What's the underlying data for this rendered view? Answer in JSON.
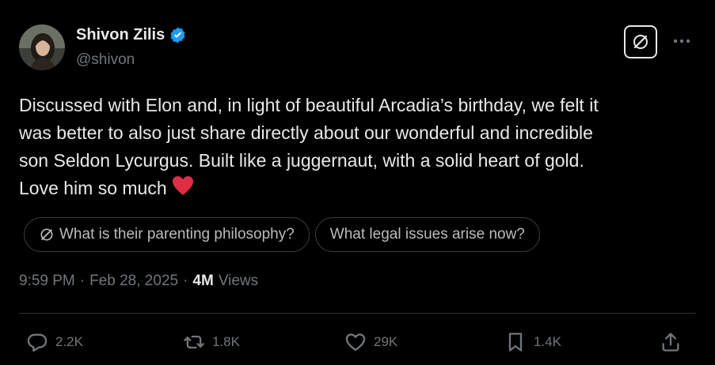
{
  "author": {
    "name": "Shivon Zilis",
    "handle": "@shivon",
    "verified": true
  },
  "tweet": {
    "text": "Discussed with Elon and, in light of beautiful Arcadia’s birthday, we felt it\nwas better to also just share directly about our wonderful and incredible\nson Seldon Lycurgus. Built like a juggernaut, with a solid heart of gold.\nLove him so much",
    "emoji": "♥"
  },
  "grok_suggestions": [
    {
      "label": "What is their parenting philosophy?",
      "icon": "grok-slash-icon"
    },
    {
      "label": "What legal issues arise now?"
    }
  ],
  "meta": {
    "time": "9:59 PM",
    "separator": "·",
    "date": "Feb 28, 2025",
    "views_count": "4M",
    "views_label": "Views"
  },
  "actions": {
    "replies": "2.2K",
    "reposts": "1.8K",
    "likes": "29K",
    "bookmarks": "1.4K"
  },
  "colors": {
    "background": "#000000",
    "text": "#e7e9ea",
    "muted": "#71767b",
    "verified": "#1d9bf0",
    "heart": "#dd2e44"
  }
}
